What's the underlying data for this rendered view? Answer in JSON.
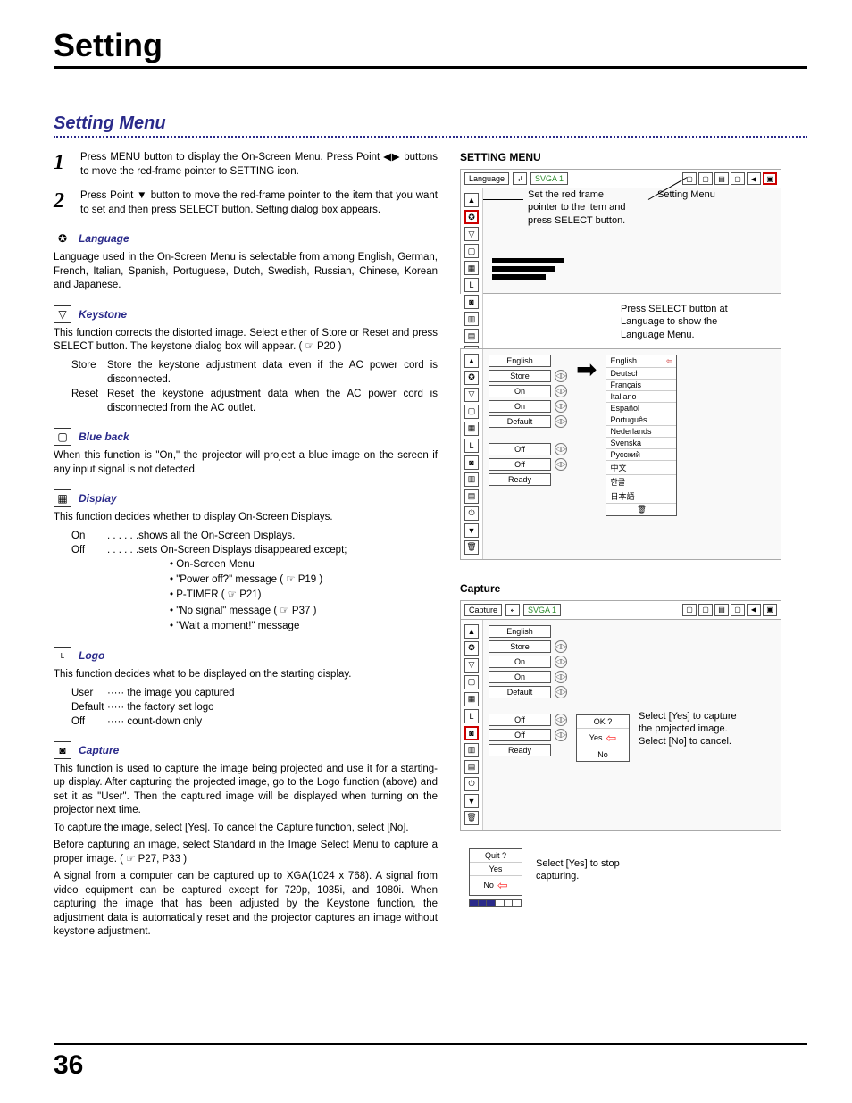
{
  "page_title": "Setting",
  "section_title": "Setting Menu",
  "page_number": "36",
  "steps": [
    {
      "num": "1",
      "text": "Press MENU button to display the On-Screen Menu.  Press Point ◀▶ buttons to move the red-frame pointer to  SETTING icon."
    },
    {
      "num": "2",
      "text": "Press Point ▼ button to move the red-frame pointer to the item that you want to set and then press SELECT button.  Setting dialog box appears."
    }
  ],
  "language": {
    "title": "Language",
    "body": "Language used in the On-Screen Menu is selectable from among English, German, French, Italian, Spanish, Portuguese, Dutch, Swedish, Russian, Chinese, Korean and Japanese."
  },
  "keystone": {
    "title": "Keystone",
    "body": "This function corrects the distorted image. Select either of Store or Reset and press SELECT button. The keystone dialog box will appear. ( ☞ P20 )",
    "rows": [
      {
        "k": "Store",
        "v": "Store the keystone adjustment data even if the AC power cord is disconnected."
      },
      {
        "k": "Reset",
        "v": "Reset the keystone adjustment data when the AC power cord is disconnected from the AC outlet."
      }
    ]
  },
  "blueback": {
    "title": "Blue back",
    "body": "When this function is \"On,\" the projector will project a blue image on the screen if any input signal is not detected."
  },
  "display": {
    "title": "Display",
    "body": "This function decides whether to display On-Screen Displays.",
    "rows": [
      {
        "k": "On",
        "v": ". . . . . .shows all the On-Screen Displays."
      },
      {
        "k": "Off",
        "v": ". . . . . .sets On-Screen Displays disappeared except;"
      }
    ],
    "bullets": [
      "• On-Screen Menu",
      "• \"Power off?\" message ( ☞ P19 )",
      "• P-TIMER ( ☞ P21)",
      "• \"No signal\" message ( ☞ P37 )",
      "• \"Wait a moment!\" message"
    ]
  },
  "logo": {
    "title": "Logo",
    "body": "This function decides what to be displayed on the starting display.",
    "rows": [
      {
        "k": "User",
        "v": "····· the image you captured"
      },
      {
        "k": "Default",
        "v": "····· the factory set logo"
      },
      {
        "k": "Off",
        "v": "····· count-down only"
      }
    ]
  },
  "capture_sec": {
    "title": "Capture",
    "p1": "This function is used to capture the image being projected and use it for a starting-up display.  After capturing the projected image, go to the Logo function (above) and set it as \"User\".  Then the captured image will be displayed when turning on the projector next time.",
    "p2": "To capture the image, select [Yes].  To cancel the Capture function, select [No].",
    "p3": "Before capturing an image, select Standard in the Image Select Menu to capture a proper image.  ( ☞ P27, P33 )",
    "p4": "A signal from a computer can be captured up to XGA(1024 x 768).  A signal from video equipment can be captured except for 720p, 1035i, and 1080i.  When capturing the image that has been adjusted by the Keystone function, the adjustment data is automatically reset and the projector captures an image without keystone adjustment."
  },
  "right": {
    "setting_menu_label": "SETTING MENU",
    "capture_label": "Capture",
    "topbar_language": "Language",
    "topbar_capture": "Capture",
    "svga": "SVGA 1",
    "callout1": "Set the red frame pointer to the item and press SELECT button.",
    "callout_setting_menu": "Setting Menu",
    "callout2": "Press SELECT button at Language to show the Language Menu.",
    "callout_capture_yes": "Select [Yes] to capture the projected image. Select [No] to cancel.",
    "callout_quit": "Select [Yes] to stop capturing.",
    "menu_vals": {
      "english": "English",
      "store": "Store",
      "on": "On",
      "default": "Default",
      "off": "Off",
      "ready": "Ready"
    },
    "langs": [
      "English",
      "Deutsch",
      "Français",
      "Italiano",
      "Español",
      "Português",
      "Nederlands",
      "Svenska",
      "Русский",
      "中文",
      "한글",
      "日本語"
    ],
    "ok_dialog": {
      "title": "OK ?",
      "yes": "Yes",
      "no": "No"
    },
    "quit_dialog": {
      "title": "Quit ?",
      "yes": "Yes",
      "no": "No"
    }
  }
}
